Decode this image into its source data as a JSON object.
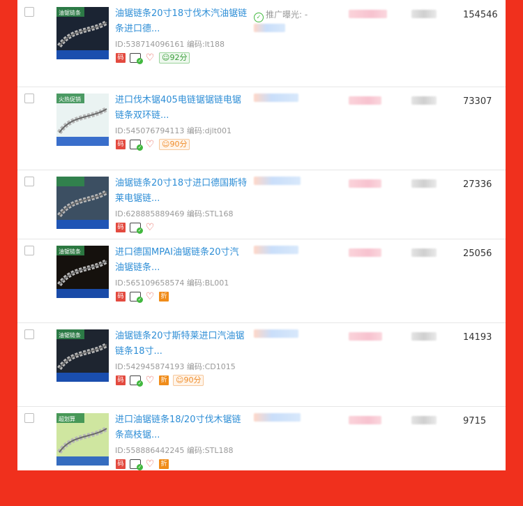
{
  "rows": [
    {
      "title": "油锯链条20寸18寸伐木汽油锯链条进口德...",
      "id_text": "ID:538714096161",
      "code_text": "编码:lt188",
      "promo": "推广曝光: -",
      "count": "154546",
      "score": "92分",
      "score_color": "green",
      "has_discount": false,
      "thumb_label": "油锯链条",
      "thumb_theme": "#1b2433"
    },
    {
      "title": "进口伐木锯405电链锯锯链电锯链条双环链...",
      "id_text": "ID:545076794113",
      "code_text": "编码:djlt001",
      "promo": "",
      "count": "73307",
      "score": "90分",
      "score_color": "orange",
      "has_discount": false,
      "thumb_label": "火热促销",
      "thumb_theme": "#eaf3f2"
    },
    {
      "title": "油锯链条20寸18寸进口德国斯特莱电锯链...",
      "id_text": "ID:628885889469",
      "code_text": "编码:STL168",
      "promo": "",
      "count": "27336",
      "score": "",
      "score_color": "",
      "has_discount": false,
      "thumb_label": "",
      "thumb_theme": "#3c4f62"
    },
    {
      "title": "进口德国MPAI油锯链条20寸汽油锯链条...",
      "id_text": "ID:565109658574",
      "code_text": "编码:BL001",
      "promo": "",
      "count": "25056",
      "score": "",
      "score_color": "",
      "has_discount": true,
      "thumb_label": "油锯链条",
      "thumb_theme": "#15110d"
    },
    {
      "title": "油锯链条20寸斯特莱进口汽油锯链条18寸...",
      "id_text": "ID:542945874193",
      "code_text": "编码:CD1015",
      "promo": "",
      "count": "14193",
      "score": "90分",
      "score_color": "orange",
      "has_discount": true,
      "thumb_label": "油锯链条",
      "thumb_theme": "#1e2530"
    },
    {
      "title": "进口油锯链条18/20寸伐木锯链条高枝锯...",
      "id_text": "ID:558886442245",
      "code_text": "编码:STL188",
      "promo": "",
      "count": "9715",
      "score": "",
      "score_color": "",
      "has_discount": true,
      "thumb_label": "超划算",
      "thumb_theme": "#cfe6a0"
    }
  ],
  "icons": {
    "code_label": "码",
    "discount_label": "折",
    "heart": "♡",
    "check": "✓"
  }
}
